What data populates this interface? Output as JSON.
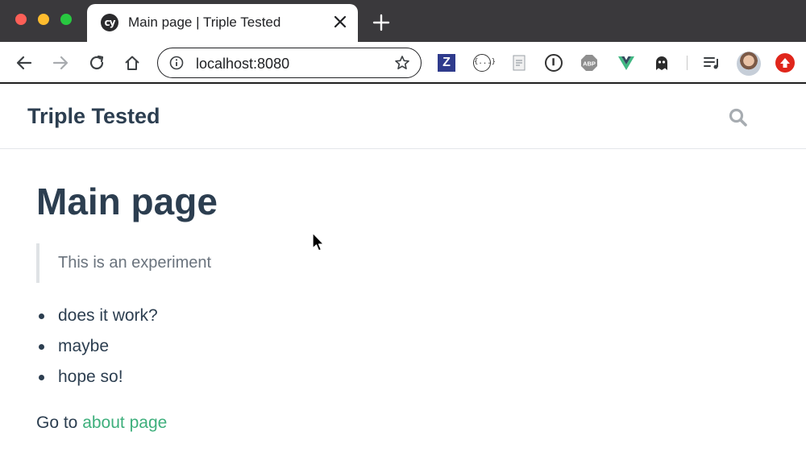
{
  "browser": {
    "tab": {
      "favicon_text": "cy",
      "title": "Main page | Triple Tested"
    },
    "omnibox": {
      "url": "localhost:8080"
    },
    "extensions": [
      {
        "name": "zotero-icon",
        "label": "Z"
      },
      {
        "name": "json-formatter-icon",
        "label": "{...}"
      },
      {
        "name": "abp-icon",
        "label": "ABP"
      }
    ],
    "colors": {
      "tabbar": "#3a393c",
      "accent_update": "#e0261b"
    }
  },
  "site": {
    "title": "Triple Tested",
    "heading": "Main page",
    "quote": "This is an experiment",
    "list": [
      "does it work?",
      "maybe",
      "hope so!"
    ],
    "goto_prefix": "Go to ",
    "goto_link": "about page",
    "colors": {
      "text": "#2c3e50",
      "link": "#3eaf7c"
    }
  }
}
